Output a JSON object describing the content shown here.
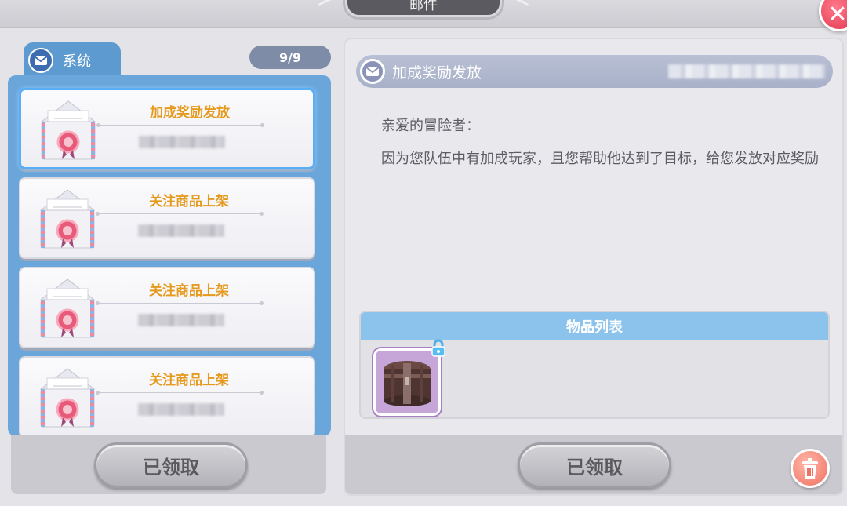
{
  "window": {
    "title": "邮件",
    "close_icon": "close-icon",
    "accent_color": "#6aa6d9"
  },
  "sidebar": {
    "tab_label": "系统",
    "tab_icon": "mail-icon",
    "count": "9/9",
    "items": [
      {
        "title": "加成奖励发放",
        "selected": true
      },
      {
        "title": "关注商品上架",
        "selected": false
      },
      {
        "title": "关注商品上架",
        "selected": false
      },
      {
        "title": "关注商品上架",
        "selected": false
      }
    ],
    "claim_button_label": "已领取"
  },
  "mail": {
    "title": "加成奖励发放",
    "greeting": "亲爱的冒险者：",
    "body": "因为您队伍中有加成玩家，且您帮助他达到了目标，给您发放对应奖励",
    "items_header": "物品列表",
    "items": [
      {
        "icon": "treasure-chest-icon",
        "locked": true
      }
    ],
    "claim_button_label": "已领取",
    "delete_icon": "trash-icon"
  }
}
